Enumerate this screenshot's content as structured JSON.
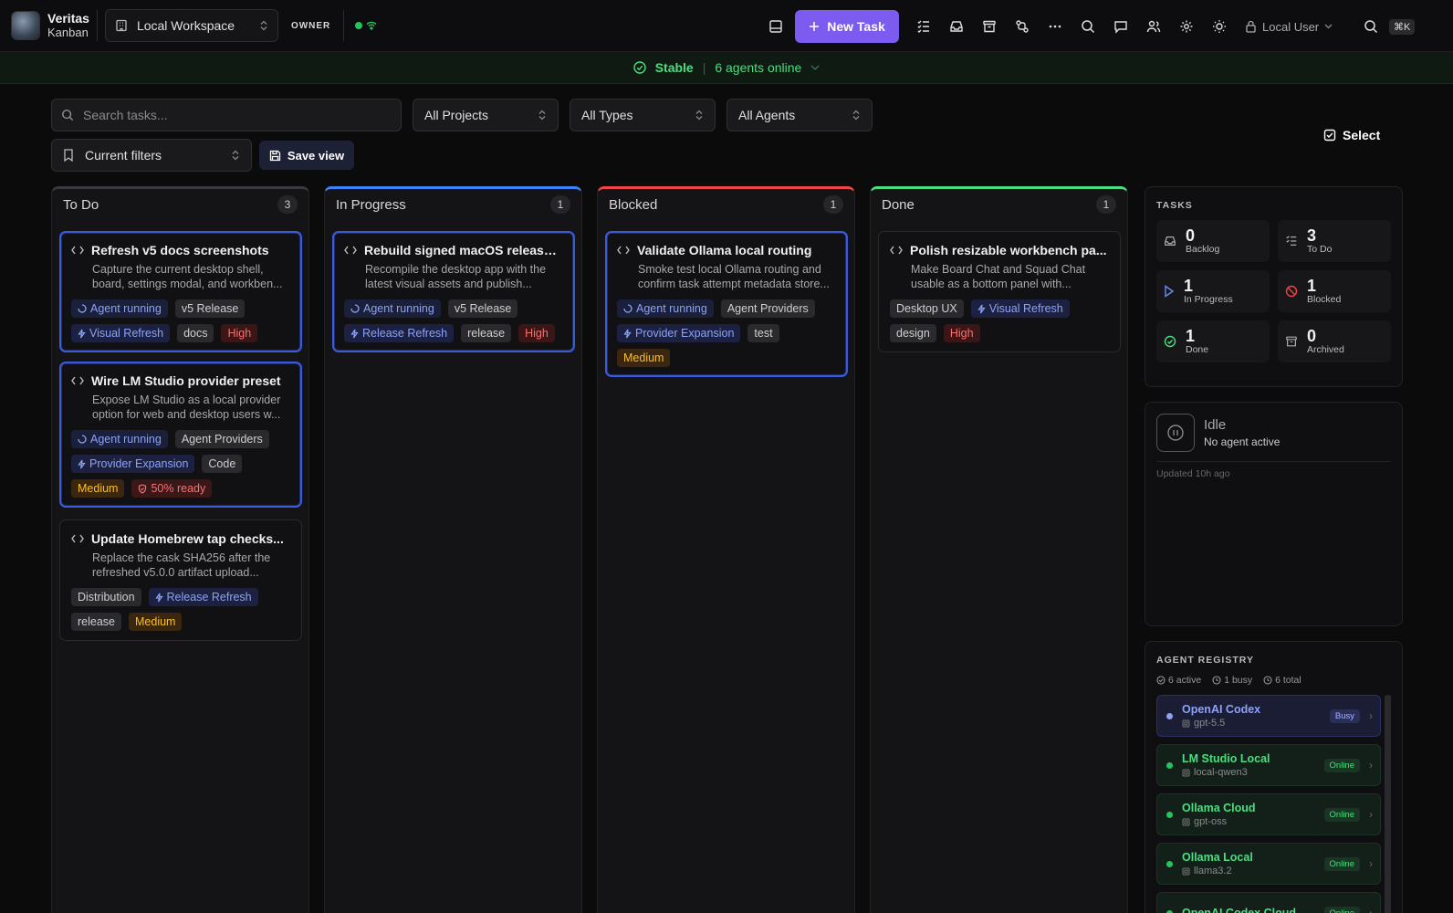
{
  "brand": {
    "name": "Veritas",
    "sub": "Kanban"
  },
  "workspace": {
    "label": "Local Workspace"
  },
  "role_badge": "OWNER",
  "toolbar": {
    "new_task_label": "New Task",
    "user_label": "Local User",
    "shortcut": "⌘K"
  },
  "status_bar": {
    "state": "Stable",
    "agents_online": "6 agents online"
  },
  "filters": {
    "search_placeholder": "Search tasks...",
    "projects": "All Projects",
    "types": "All Types",
    "agents": "All Agents",
    "saved": "Current filters",
    "save_view_label": "Save view",
    "select_label": "Select"
  },
  "columns": [
    {
      "title": "To Do",
      "count": "3",
      "accent": "#3a3a3e",
      "cards": [
        {
          "title": "Refresh v5 docs screenshots",
          "desc1": "Capture the current desktop shell,",
          "desc2": "board, settings modal, and workben...",
          "tags": [
            {
              "k": "agent",
              "t": "Agent running"
            },
            {
              "k": "gray",
              "t": "v5 Release"
            },
            {
              "k": "proj",
              "t": "Visual Refresh"
            },
            {
              "k": "gray",
              "t": "docs"
            },
            {
              "k": "high",
              "t": "High"
            }
          ]
        },
        {
          "title": "Wire LM Studio provider preset",
          "desc1": "Expose LM Studio as a local provider",
          "desc2": "option for web and desktop users w...",
          "tags": [
            {
              "k": "agent",
              "t": "Agent running"
            },
            {
              "k": "gray",
              "t": "Agent Providers"
            },
            {
              "k": "proj",
              "t": "Provider Expansion"
            },
            {
              "k": "gray",
              "t": "Code"
            },
            {
              "k": "med",
              "t": "Medium"
            },
            {
              "k": "ready",
              "t": "50% ready"
            }
          ]
        },
        {
          "title": "Update Homebrew tap checks...",
          "desc1": "Replace the cask SHA256 after the",
          "desc2": "refreshed v5.0.0 artifact upload...",
          "tags": [
            {
              "k": "gray",
              "t": "Distribution"
            },
            {
              "k": "proj",
              "t": "Release Refresh"
            },
            {
              "k": "gray",
              "t": "release"
            },
            {
              "k": "med",
              "t": "Medium"
            }
          ]
        }
      ]
    },
    {
      "title": "In Progress",
      "count": "1",
      "accent": "#3b82f6",
      "cards": [
        {
          "title": "Rebuild signed macOS release ...",
          "desc1": "Recompile the desktop app with the",
          "desc2": "latest visual assets and publish...",
          "tags": [
            {
              "k": "agent",
              "t": "Agent running"
            },
            {
              "k": "gray",
              "t": "v5 Release"
            },
            {
              "k": "proj",
              "t": "Release Refresh"
            },
            {
              "k": "gray",
              "t": "release"
            },
            {
              "k": "high",
              "t": "High"
            }
          ]
        }
      ]
    },
    {
      "title": "Blocked",
      "count": "1",
      "accent": "#ef4444",
      "cards": [
        {
          "title": "Validate Ollama local routing",
          "desc1": "Smoke test local Ollama routing and",
          "desc2": "confirm task attempt metadata store...",
          "tags": [
            {
              "k": "agent",
              "t": "Agent running"
            },
            {
              "k": "gray",
              "t": "Agent Providers"
            },
            {
              "k": "proj",
              "t": "Provider Expansion"
            },
            {
              "k": "gray",
              "t": "test"
            },
            {
              "k": "med",
              "t": "Medium"
            }
          ]
        }
      ]
    },
    {
      "title": "Done",
      "count": "1",
      "accent": "#4ade80",
      "cards": [
        {
          "title": "Polish resizable workbench pa...",
          "desc1": "Make Board Chat and Squad Chat",
          "desc2": "usable as a bottom panel with...",
          "tags": [
            {
              "k": "gray",
              "t": "Desktop UX"
            },
            {
              "k": "proj",
              "t": "Visual Refresh"
            },
            {
              "k": "gray",
              "t": "design"
            },
            {
              "k": "high",
              "t": "High"
            }
          ]
        }
      ]
    }
  ],
  "tasks_panel": {
    "heading": "TASKS",
    "stats": [
      {
        "n": "0",
        "l": "Backlog"
      },
      {
        "n": "3",
        "l": "To Do"
      },
      {
        "n": "1",
        "l": "In Progress"
      },
      {
        "n": "1",
        "l": "Blocked"
      },
      {
        "n": "1",
        "l": "Done"
      },
      {
        "n": "0",
        "l": "Archived"
      }
    ]
  },
  "idle_panel": {
    "title": "Idle",
    "sub": "No agent active",
    "updated": "Updated 10h ago"
  },
  "registry": {
    "heading": "AGENT REGISTRY",
    "active": "6 active",
    "busy": "1 busy",
    "total": "6 total",
    "agents": [
      {
        "name": "OpenAI Codex",
        "model": "gpt-5.5",
        "status": "Busy"
      },
      {
        "name": "LM Studio Local",
        "model": "local-qwen3",
        "status": "Online"
      },
      {
        "name": "Ollama Cloud",
        "model": "gpt-oss",
        "status": "Online"
      },
      {
        "name": "Ollama Local",
        "model": "llama3.2",
        "status": "Online"
      },
      {
        "name": "OpenAI Codex Cloud",
        "model": "",
        "status": "Online"
      }
    ]
  }
}
